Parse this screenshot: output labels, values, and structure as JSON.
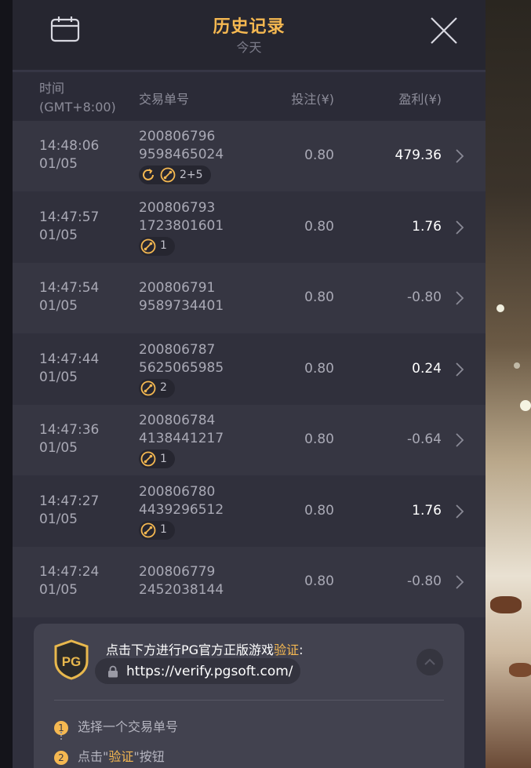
{
  "header": {
    "title": "历史记录",
    "subtitle": "今天",
    "calendar_icon": "calendar-icon",
    "close_icon": "close-icon"
  },
  "columns": {
    "time": "时间",
    "timezone": "(GMT+8:00)",
    "order": "交易单号",
    "bet": "投注(¥)",
    "profit": "盈利(¥)"
  },
  "rows": [
    {
      "time": "14:48:06",
      "date": "01/05",
      "order1": "200806796",
      "order2": "9598465024",
      "bet": "0.80",
      "profit": "479.36",
      "positive": true,
      "badge": "2+5",
      "badge_icons": [
        "respin-icon",
        "free-spin-icon"
      ]
    },
    {
      "time": "14:47:57",
      "date": "01/05",
      "order1": "200806793",
      "order2": "1723801601",
      "bet": "0.80",
      "profit": "1.76",
      "positive": true,
      "badge": "1",
      "badge_icons": [
        "free-spin-icon"
      ]
    },
    {
      "time": "14:47:54",
      "date": "01/05",
      "order1": "200806791",
      "order2": "9589734401",
      "bet": "0.80",
      "profit": "-0.80",
      "positive": false,
      "badge": null
    },
    {
      "time": "14:47:44",
      "date": "01/05",
      "order1": "200806787",
      "order2": "5625065985",
      "bet": "0.80",
      "profit": "0.24",
      "positive": true,
      "badge": "2",
      "badge_icons": [
        "free-spin-icon"
      ]
    },
    {
      "time": "14:47:36",
      "date": "01/05",
      "order1": "200806784",
      "order2": "4138441217",
      "bet": "0.80",
      "profit": "-0.64",
      "positive": false,
      "badge": "1",
      "badge_icons": [
        "free-spin-icon"
      ]
    },
    {
      "time": "14:47:27",
      "date": "01/05",
      "order1": "200806780",
      "order2": "4439296512",
      "bet": "0.80",
      "profit": "1.76",
      "positive": true,
      "badge": "1",
      "badge_icons": [
        "free-spin-icon"
      ]
    },
    {
      "time": "14:47:24",
      "date": "01/05",
      "order1": "200806779",
      "order2": "2452038144",
      "bet": "0.80",
      "profit": "-0.80",
      "positive": false,
      "badge": null
    }
  ],
  "verify": {
    "title_prefix": "点击下方进行PG官方正版游戏",
    "title_highlight": "验证",
    "title_suffix": ":",
    "logo_text": "PG",
    "url": "https://verify.pgsoft.com/",
    "step1_num": "1",
    "step1": "选择一个交易单号",
    "step2_num": "2",
    "step2_prefix": "点击\"",
    "step2_highlight": "验证",
    "step2_suffix": "\"按钮"
  },
  "colors": {
    "accent": "#f5b851",
    "panel": "#30303d",
    "header": "#262630"
  }
}
